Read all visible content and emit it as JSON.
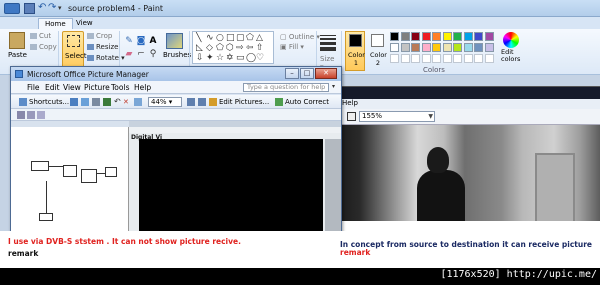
{
  "paint": {
    "title": "source problem4 - Paint",
    "tabs": [
      {
        "label": "Home"
      },
      {
        "label": "View"
      }
    ],
    "clipboard": {
      "paste": "Paste",
      "cut": "Cut",
      "copy": "Copy"
    },
    "image": {
      "select": "Select",
      "crop": "Crop",
      "resize": "Resize",
      "rotate": "Rotate"
    },
    "brushes": "Brushes",
    "shapes": {
      "outline": "Outline",
      "fill": "Fill"
    },
    "size": "Size",
    "color1": "Color 1",
    "color2": "Color 2",
    "colors_label": "Colors",
    "edit_colors": "Edit colors",
    "palette_row1": [
      "#000000",
      "#7f7f7f",
      "#880015",
      "#ed1c24",
      "#ff7f27",
      "#fff200",
      "#22b14c",
      "#00a2e8",
      "#3f48cc",
      "#a349a4"
    ],
    "palette_row2": [
      "#ffffff",
      "#c3c3c3",
      "#b97a57",
      "#ffaec9",
      "#ffc90e",
      "#efe4b0",
      "#b5e61d",
      "#99d9ea",
      "#7092be",
      "#c8bfe7"
    ],
    "color1_value": "#000000",
    "color2_value": "#ffffff"
  },
  "picture_manager": {
    "title": "Microsoft Office Picture Manager",
    "menus": [
      "File",
      "Edit",
      "View",
      "Picture",
      "Tools",
      "Help"
    ],
    "help_placeholder": "Type a question for help",
    "toolbar": {
      "shortcuts": "Shortcuts...",
      "zoom": "44%",
      "edit_pictures": "Edit Pictures...",
      "auto_correct": "Auto Correct"
    },
    "nested": {
      "dvb_label": "Digital Vi"
    }
  },
  "video_window": {
    "menu_help": "Help",
    "zoom": "155%"
  },
  "annotations": {
    "left_text": "I use via DVB-S ststem . It can not show picture recive.",
    "left_remark": "remark",
    "right_text": "In concept from source to destination it can receive picture",
    "right_remark": "remark"
  },
  "watermark": "[1176x520] http://upic.me/"
}
